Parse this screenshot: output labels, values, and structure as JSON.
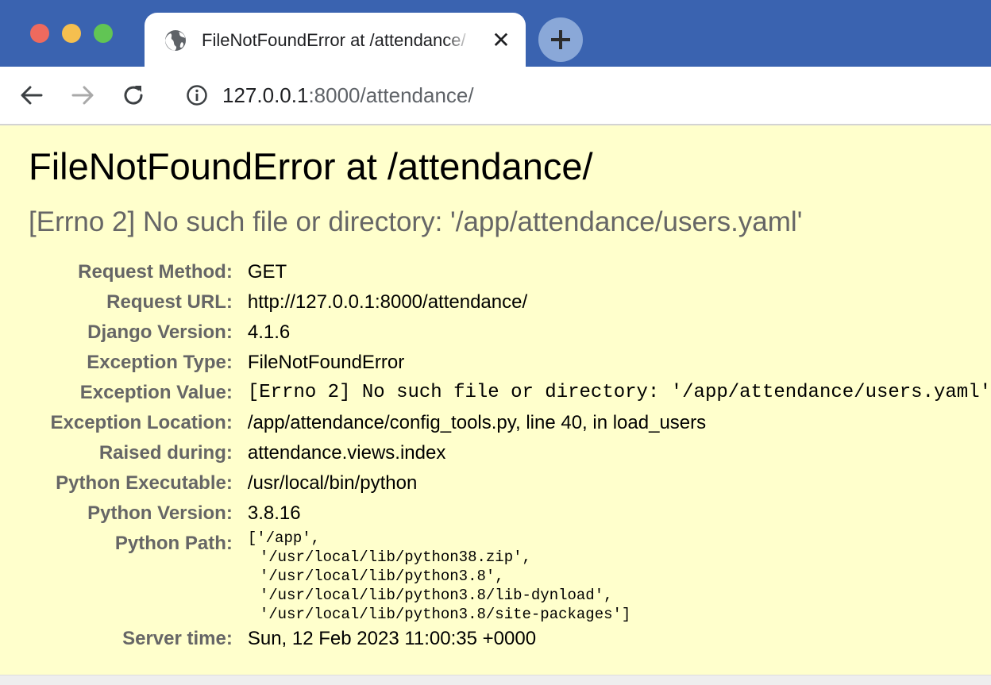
{
  "browser": {
    "tab_title": "FileNotFoundError at /attendance/",
    "tab_close_glyph": "✕",
    "url_host": "127.0.0.1",
    "url_rest": ":8000/attendance/",
    "icons": {
      "tab": "globe-icon",
      "new_tab": "plus-icon",
      "back": "arrow-left-icon",
      "forward": "arrow-right-icon",
      "reload": "reload-icon",
      "site_info": "info-icon"
    },
    "colors": {
      "titlebar": "#3a63b0",
      "traffic_red": "#ee6a5e",
      "traffic_yellow": "#f5bf4f",
      "traffic_green": "#61c554"
    }
  },
  "page": {
    "background": "#ffffcc",
    "title": "FileNotFoundError at /attendance/",
    "subtitle": "[Errno 2] No such file or directory: '/app/attendance/users.yaml'",
    "summary": [
      {
        "label": "Request Method:",
        "value": "GET"
      },
      {
        "label": "Request URL:",
        "value": "http://127.0.0.1:8000/attendance/"
      },
      {
        "label": "Django Version:",
        "value": "4.1.6"
      },
      {
        "label": "Exception Type:",
        "value": "FileNotFoundError"
      },
      {
        "label": "Exception Value:",
        "value": "[Errno 2] No such file or directory: '/app/attendance/users.yaml'"
      },
      {
        "label": "Exception Location:",
        "value": "/app/attendance/config_tools.py, line 40, in load_users"
      },
      {
        "label": "Raised during:",
        "value": "attendance.views.index"
      },
      {
        "label": "Python Executable:",
        "value": "/usr/local/bin/python"
      },
      {
        "label": "Python Version:",
        "value": "3.8.16"
      },
      {
        "label": "Python Path:",
        "value": [
          "['/app',",
          "'/usr/local/lib/python38.zip',",
          "'/usr/local/lib/python3.8',",
          "'/usr/local/lib/python3.8/lib-dynload',",
          "'/usr/local/lib/python3.8/site-packages']"
        ]
      },
      {
        "label": "Server time:",
        "value": "Sun, 12 Feb 2023 11:00:35 +0000"
      }
    ]
  }
}
